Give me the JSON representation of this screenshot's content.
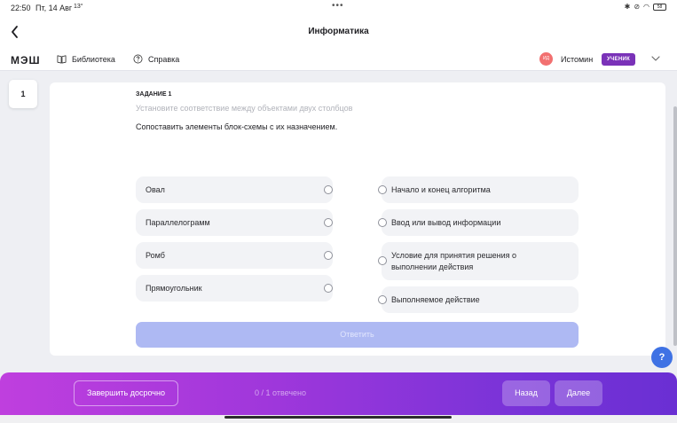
{
  "status_bar": {
    "time": "22:50",
    "date": "Пт, 14 Авг",
    "temperature": "13°",
    "dots": "•••",
    "battery": "58"
  },
  "header": {
    "title": "Информатика"
  },
  "nav": {
    "logo": "МЭШ",
    "library_label": "Библиотека",
    "help_label": "Справка",
    "avatar_initials": "ИД",
    "user_name": "Истомин",
    "role_badge": "УЧЕНИК"
  },
  "task_tile": {
    "number": "1"
  },
  "task": {
    "label": "ЗАДАНИЕ 1",
    "instruction": "Установите соответствие между объектами двух столбцов",
    "question": "Сопоставить элементы блок-схемы с их назначением.",
    "left_items": [
      "Овал",
      "Параллелограмм",
      "Ромб",
      "Прямоугольник"
    ],
    "right_items": [
      "Начало и конец алгоритма",
      "Ввод или вывод информации",
      "Условие для принятия решения о выполнении действия",
      "Выполняемое действие"
    ],
    "answer_button": "Ответить"
  },
  "help_fab": "?",
  "bottom_bar": {
    "finish_button": "Завершить досрочно",
    "progress": "0 / 1 отвечено",
    "back_button": "Назад",
    "next_button": "Далее"
  },
  "colors": {
    "accent": "#7a32b8",
    "answer_button": "#aeb9f3",
    "help_fab": "#3f72e4",
    "bottom_gradient_start": "#bf3fde",
    "bottom_gradient_end": "#6a2fd3"
  }
}
